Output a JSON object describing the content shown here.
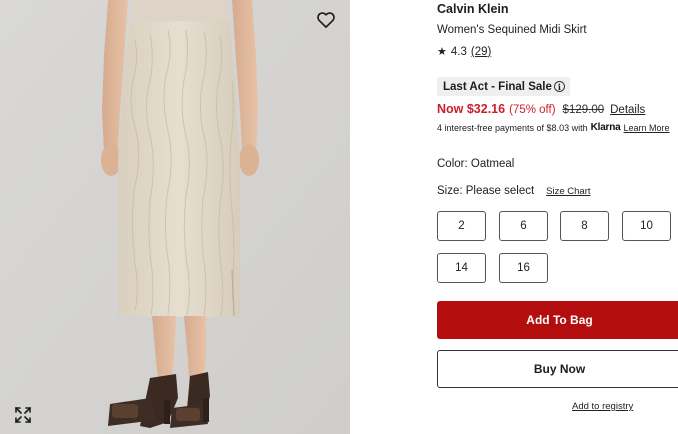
{
  "gallery": {
    "favorite_icon": "heart-outline-icon",
    "expand_icon": "expand-arrows-icon"
  },
  "product": {
    "brand": "Calvin Klein",
    "name": "Women's Sequined Midi Skirt",
    "rating": "4.3",
    "review_count": "(29)",
    "star_icon": "star-icon"
  },
  "sale": {
    "badge": "Last Act - Final Sale",
    "info_icon": "info-icon",
    "info_glyph": "i"
  },
  "price": {
    "now": "Now $32.16",
    "off": "(75% off)",
    "was": "$129.00",
    "details_link": "Details"
  },
  "klarna": {
    "text": "4 interest-free payments of $8.03 with",
    "logo": "Klarna",
    "learn_more": "Learn More"
  },
  "color": {
    "label": "Color: Oatmeal"
  },
  "size": {
    "label": "Size: Please select",
    "chart_link": "Size Chart",
    "options": [
      "2",
      "6",
      "8",
      "10",
      "14",
      "16"
    ]
  },
  "actions": {
    "add_to_bag": "Add To Bag",
    "buy_now": "Buy Now",
    "registry": "Add to registry"
  },
  "colors": {
    "sale_red": "#cc1f2b",
    "add_button": "#b30d0d",
    "image_bg": "#d4d3d1"
  }
}
